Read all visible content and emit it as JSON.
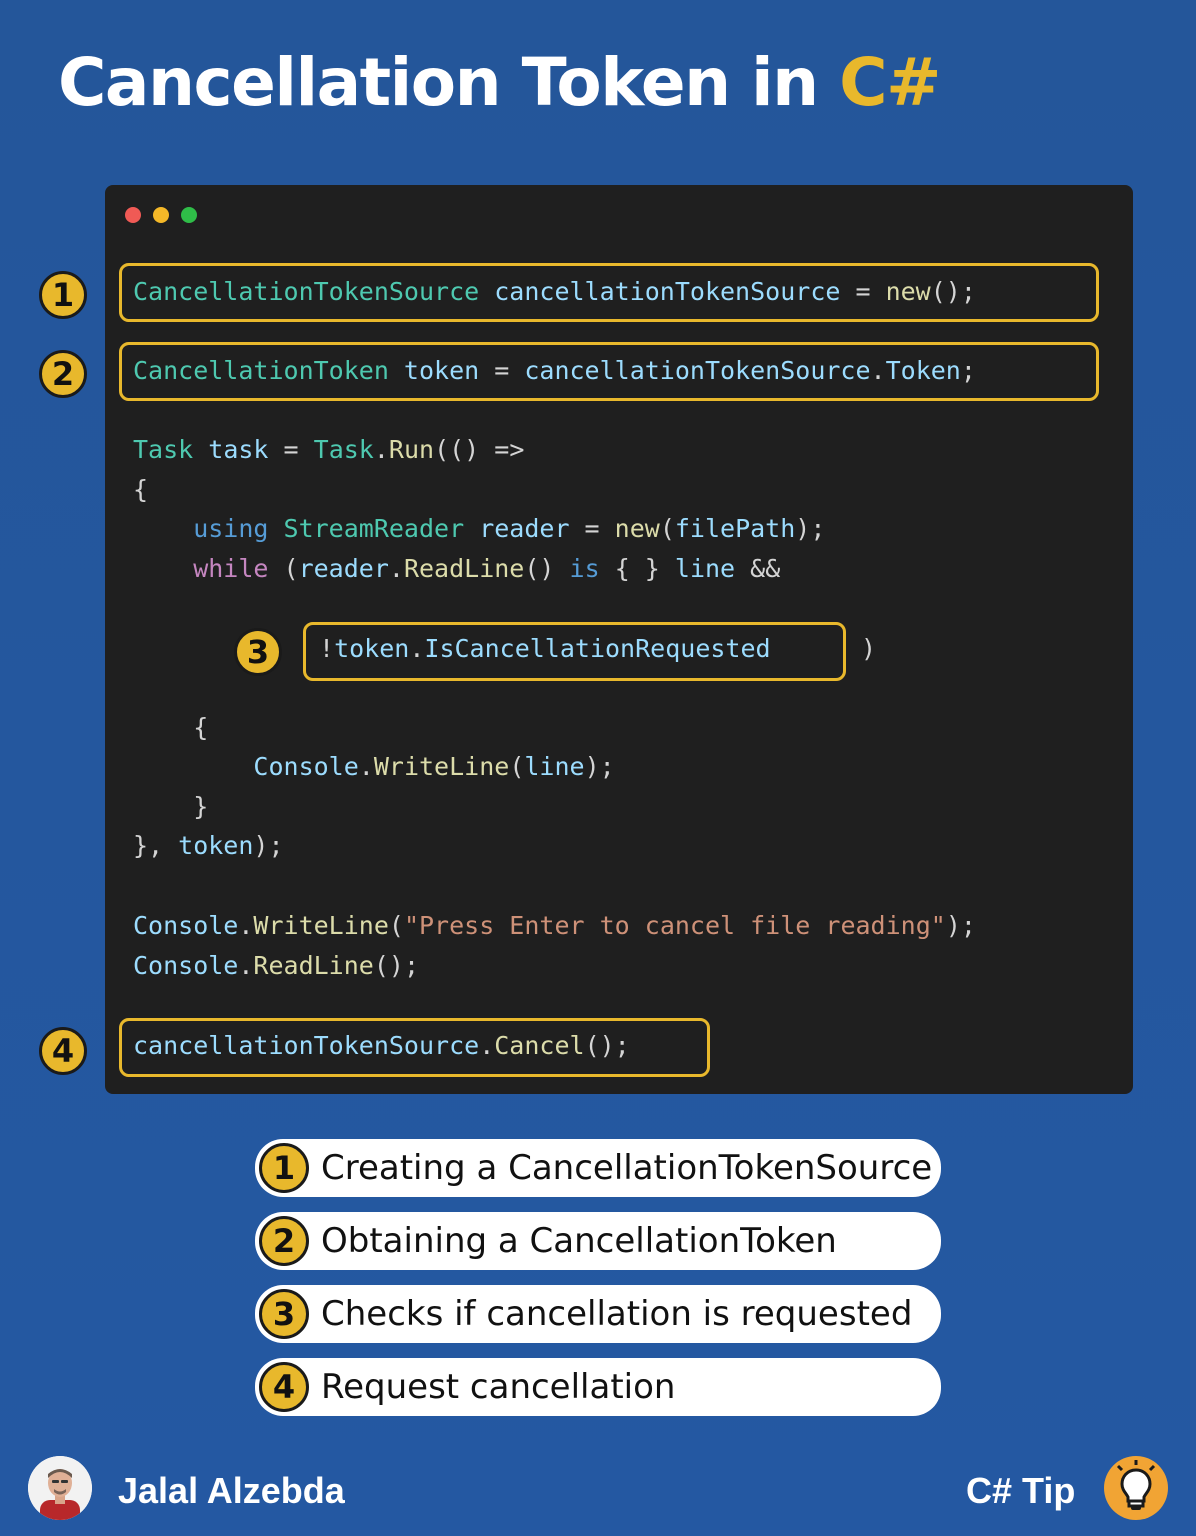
{
  "header": {
    "title_main": "Cancellation Token in ",
    "title_accent": "C#"
  },
  "code": {
    "line1": [
      "CancellationTokenSource",
      " cancellationTokenSource",
      " = ",
      "new",
      "();"
    ],
    "line2": [
      "CancellationToken",
      " token",
      " = ",
      "cancellationTokenSource",
      ".",
      "Token",
      ";"
    ],
    "line3": [
      "Task",
      " task",
      " = ",
      "Task",
      ".",
      "Run",
      "(() =>"
    ],
    "line4": "{",
    "line5": [
      "    using ",
      "StreamReader",
      " reader",
      " = ",
      "new",
      "(",
      "filePath",
      ");"
    ],
    "line6": [
      "    while",
      " (",
      "reader",
      ".",
      "ReadLine",
      "() ",
      "is",
      " { } ",
      "line",
      " &&"
    ],
    "line7a": "!",
    "line7b": "token",
    "line7c": ".",
    "line7d": "IsCancellationRequested",
    "line7e": ")",
    "line8": "    {",
    "line9": [
      "        Console",
      ".",
      "WriteLine",
      "(",
      "line",
      ");"
    ],
    "line10": "    }",
    "line11": [
      "}, ",
      "token",
      ");"
    ],
    "line12": [
      "Console",
      ".",
      "WriteLine",
      "(",
      "\"Press Enter to cancel file reading\"",
      ");"
    ],
    "line13": [
      "Console",
      ".",
      "ReadLine",
      "();"
    ],
    "line14": [
      "cancellationTokenSource",
      ".",
      "Cancel",
      "();"
    ]
  },
  "badges": [
    "1",
    "2",
    "3",
    "4"
  ],
  "legend": [
    {
      "num": "1",
      "text": "Creating a CancellationTokenSource"
    },
    {
      "num": "2",
      "text": "Obtaining a CancellationToken"
    },
    {
      "num": "3",
      "text": "Checks if cancellation is requested"
    },
    {
      "num": "4",
      "text": "Request cancellation"
    }
  ],
  "footer": {
    "author": "Jalal Alzebda",
    "tag": "C# Tip"
  },
  "colors": {
    "background": "#2458a2",
    "accent": "#e8b82c",
    "code_bg": "#1f1f1f"
  },
  "icons": [
    "avatar-photo",
    "lightbulb-icon"
  ]
}
